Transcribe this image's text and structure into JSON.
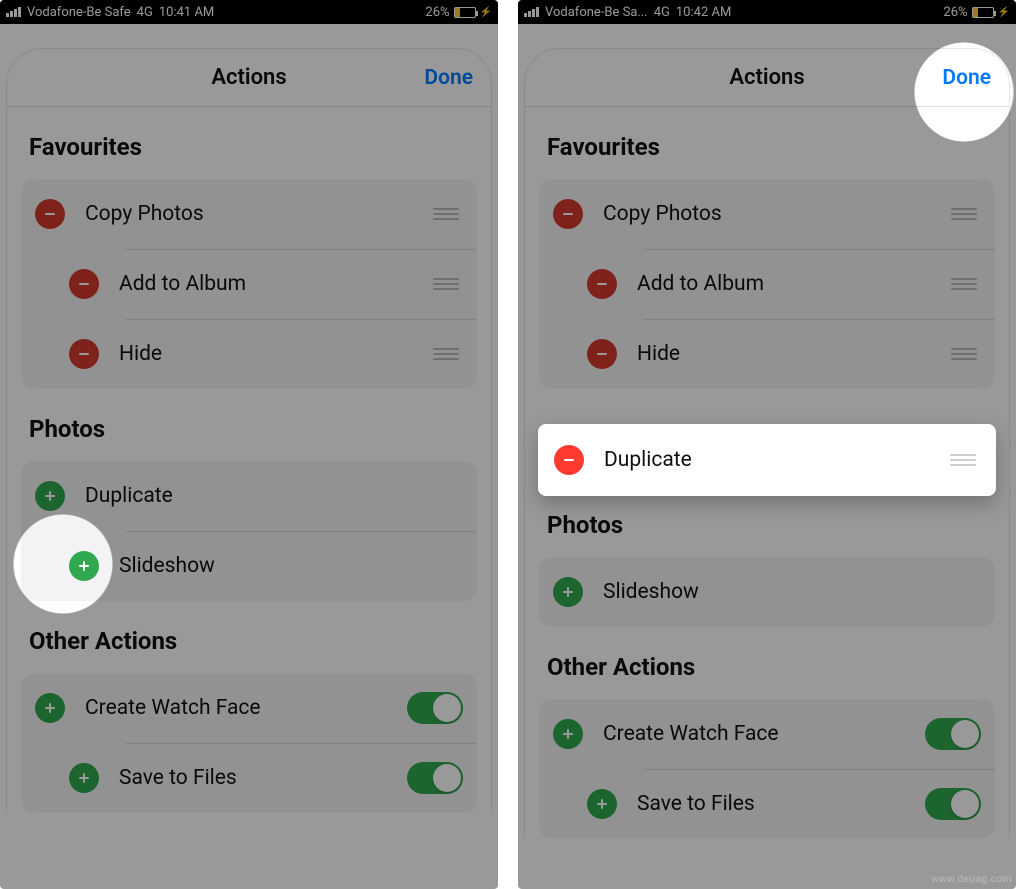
{
  "left": {
    "status": {
      "carrier": "Vodafone-Be Safe",
      "nettype": "4G",
      "time": "10:41 AM",
      "battery": "26%"
    },
    "nav": {
      "title": "Actions",
      "done": "Done"
    },
    "sections": {
      "favourites": {
        "title": "Favourites",
        "items": [
          {
            "label": "Copy Photos"
          },
          {
            "label": "Add to Album"
          },
          {
            "label": "Hide"
          }
        ]
      },
      "photos": {
        "title": "Photos",
        "items": [
          {
            "label": "Duplicate"
          },
          {
            "label": "Slideshow"
          }
        ]
      },
      "other": {
        "title": "Other Actions",
        "items": [
          {
            "label": "Create Watch Face"
          },
          {
            "label": "Save to Files"
          }
        ]
      }
    }
  },
  "right": {
    "status": {
      "carrier": "Vodafone-Be Sa...",
      "nettype": "4G",
      "time": "10:42 AM",
      "battery": "26%"
    },
    "nav": {
      "title": "Actions",
      "done": "Done"
    },
    "sections": {
      "favourites": {
        "title": "Favourites",
        "items": [
          {
            "label": "Copy Photos"
          },
          {
            "label": "Add to Album"
          },
          {
            "label": "Hide"
          }
        ]
      },
      "floating": {
        "label": "Duplicate"
      },
      "photos": {
        "title": "Photos",
        "items": [
          {
            "label": "Slideshow"
          }
        ]
      },
      "other": {
        "title": "Other Actions",
        "items": [
          {
            "label": "Create Watch Face"
          },
          {
            "label": "Save to Files"
          }
        ]
      }
    }
  },
  "watermark": "www.deuag.com"
}
